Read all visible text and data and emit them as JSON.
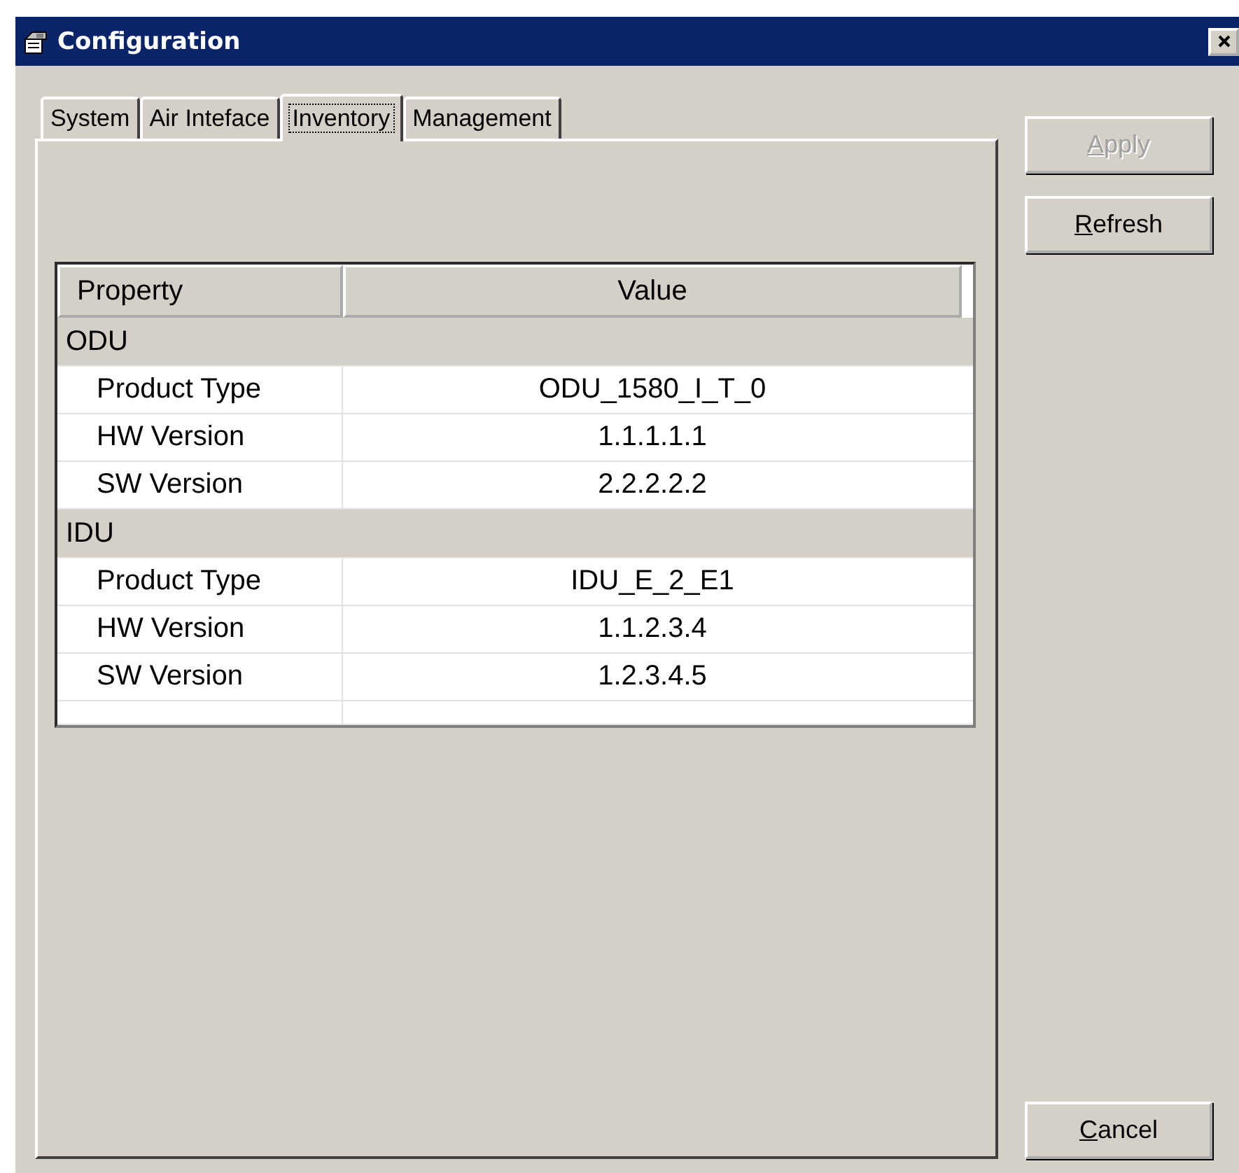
{
  "window": {
    "title": "Configuration"
  },
  "tabs": [
    {
      "label": "System",
      "selected": false
    },
    {
      "label": "Air Inteface",
      "selected": false
    },
    {
      "label": "Inventory",
      "selected": true
    },
    {
      "label": "Management",
      "selected": false
    }
  ],
  "table": {
    "columns": [
      "Property",
      "Value"
    ],
    "groups": [
      {
        "name": "ODU",
        "rows": [
          {
            "property": "Product Type",
            "value": "ODU_1580_I_T_0"
          },
          {
            "property": "HW Version",
            "value": "1.1.1.1.1"
          },
          {
            "property": "SW Version",
            "value": "2.2.2.2.2"
          }
        ]
      },
      {
        "name": "IDU",
        "rows": [
          {
            "property": "Product Type",
            "value": "IDU_E_2_E1"
          },
          {
            "property": "HW Version",
            "value": "1.1.2.3.4"
          },
          {
            "property": "SW Version",
            "value": "1.2.3.4.5"
          }
        ]
      }
    ]
  },
  "buttons": [
    {
      "label": "Apply",
      "disabled": true
    },
    {
      "label": "Refresh",
      "disabled": false
    }
  ],
  "footer_buttons": [
    {
      "label": "Cancel",
      "disabled": false
    }
  ]
}
